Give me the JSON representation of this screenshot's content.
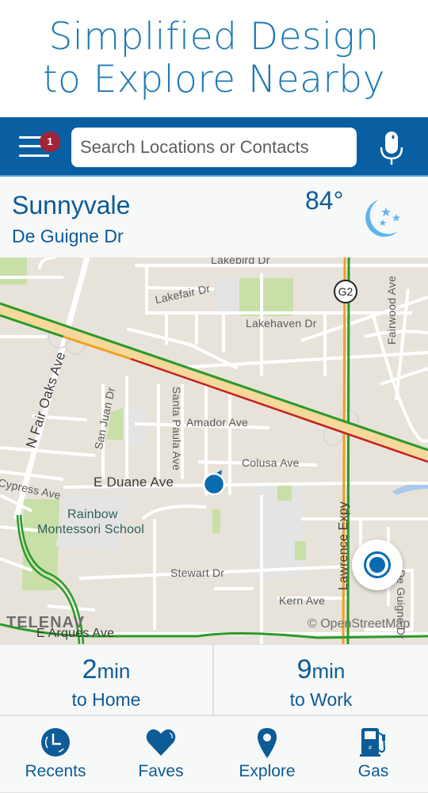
{
  "promo": {
    "line1": "Simplified Design",
    "line2": "to Explore Nearby"
  },
  "topbar": {
    "menu_badge": "1",
    "search_placeholder": "Search Locations or Contacts",
    "menu_icon": "hamburger-menu-icon",
    "mic_icon": "microphone-icon"
  },
  "location": {
    "city": "Sunnyvale",
    "street": "De Guigne Dr",
    "temperature": "84°",
    "weather_icon": "moon-stars-icon"
  },
  "map": {
    "labels": {
      "lakebird": "Lakebird Dr",
      "lakefair": "Lakefair Dr",
      "lakehaven": "Lakehaven Dr",
      "fairwood": "Fairwood Ave",
      "n_fair_oaks": "N Fair Oaks Ave",
      "san_juan": "San Juan Dr",
      "santa_paula": "Santa Paula Ave",
      "amador": "Amador Ave",
      "colusa": "Colusa Ave",
      "cypress": "Cypress Ave",
      "e_duane": "E Duane Ave",
      "rainbow1": "Rainbow",
      "rainbow2": "Montessori School",
      "stewart": "Stewart Dr",
      "kern": "Kern Ave",
      "lawrence": "Lawrence Expy",
      "de_guigne": "De Guigne Dr",
      "e_arques": "E Arques Ave",
      "g2_shield": "G2"
    },
    "brand": "TELENAV",
    "attribution": "© OpenStreetMap",
    "colors": {
      "land": "#e8e3da",
      "road": "#ffffff",
      "park": "#c8dfa8",
      "school": "#e4e4e4",
      "water": "#a8c8ec",
      "highway": "#f4d89c",
      "traffic_green": "#2a9a2a",
      "traffic_orange": "#f0a020",
      "traffic_red": "#c62020",
      "location_blue": "#0a6cb0"
    }
  },
  "eta": [
    {
      "value": "2",
      "unit": "min",
      "destination": "to Home"
    },
    {
      "value": "9",
      "unit": "min",
      "destination": "to Work"
    }
  ],
  "nav": [
    {
      "label": "Recents",
      "icon": "clock-icon"
    },
    {
      "label": "Faves",
      "icon": "heart-icon"
    },
    {
      "label": "Explore",
      "icon": "map-pin-icon"
    },
    {
      "label": "Gas",
      "icon": "gas-pump-icon"
    }
  ],
  "theme": {
    "primary": "#0a5fa3",
    "text_blue": "#0d5b97",
    "promo_blue": "#1f7ab5",
    "badge_red": "#a32237",
    "weather_blue": "#5db5f0"
  }
}
